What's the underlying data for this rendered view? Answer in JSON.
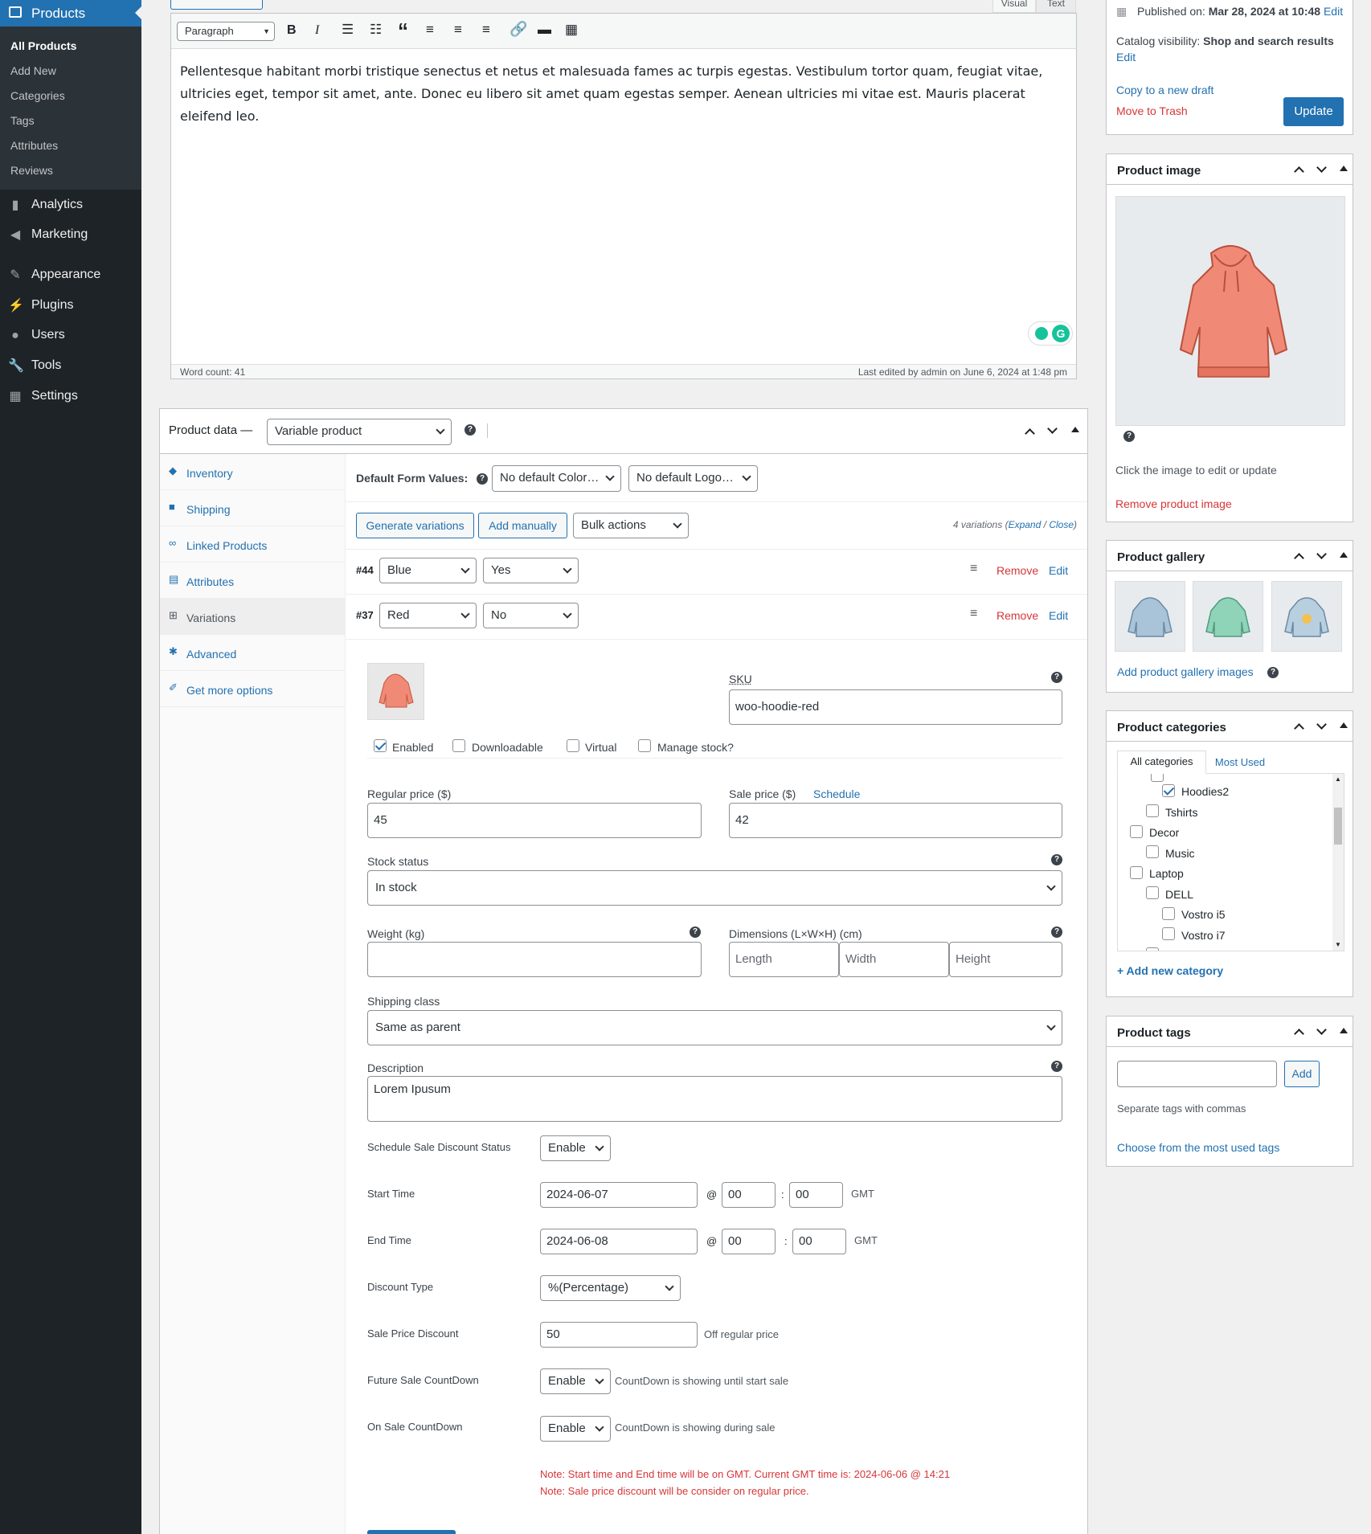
{
  "sidebar": {
    "products_label": "Products",
    "submenu": [
      "All Products",
      "Add New",
      "Categories",
      "Tags",
      "Attributes",
      "Reviews"
    ],
    "menu": [
      {
        "label": "Analytics",
        "icon": "bar-chart-icon"
      },
      {
        "label": "Marketing",
        "icon": "megaphone-icon"
      },
      {
        "label": "Appearance",
        "icon": "paintbrush-icon"
      },
      {
        "label": "Plugins",
        "icon": "plug-icon"
      },
      {
        "label": "Users",
        "icon": "user-icon"
      },
      {
        "label": "Tools",
        "icon": "wrench-icon"
      },
      {
        "label": "Settings",
        "icon": "settings-icon"
      }
    ]
  },
  "editor": {
    "tab_visual": "Visual",
    "tab_text": "Text",
    "format_select": "Paragraph",
    "content": "Pellentesque habitant morbi tristique senectus et netus et malesuada fames ac turpis egestas. Vestibulum tortor quam, feugiat vitae, ultricies eget, tempor sit amet, ante. Donec eu libero sit amet quam egestas semper. Aenean ultricies mi vitae est. Mauris placerat eleifend leo.",
    "word_count": "Word count: 41",
    "last_edited": "Last edited by admin on June 6, 2024 at 1:48 pm"
  },
  "product_data": {
    "title": "Product data —",
    "type_select": "Variable product",
    "tabs": [
      "Inventory",
      "Shipping",
      "Linked Products",
      "Attributes",
      "Variations",
      "Advanced",
      "Get more options"
    ],
    "default_form_values_label": "Default Form Values:",
    "default_color": "No default Color…",
    "default_logo": "No default Logo…",
    "generate_variations": "Generate variations",
    "add_manually": "Add manually",
    "bulk_actions": "Bulk actions",
    "variations_count": "4 variations",
    "expand": "Expand",
    "slash": "/",
    "close": "Close",
    "variations": [
      {
        "id": "#44",
        "color": "Blue",
        "logo": "Yes",
        "remove": "Remove",
        "edit": "Edit"
      },
      {
        "id": "#37",
        "color": "Red",
        "logo": "No",
        "remove": "Remove",
        "edit": "Edit"
      }
    ],
    "variation_detail": {
      "sku_label": "SKU",
      "sku_value": "woo-hoodie-red",
      "enabled": "Enabled",
      "downloadable": "Downloadable",
      "virtual": "Virtual",
      "manage_stock": "Manage stock?",
      "regular_price_label": "Regular price ($)",
      "regular_price": "45",
      "sale_price_label": "Sale price ($)",
      "schedule": "Schedule",
      "sale_price": "42",
      "stock_status_label": "Stock status",
      "stock_status": "In stock",
      "weight_label": "Weight (kg)",
      "dimensions_label": "Dimensions (L×W×H) (cm)",
      "length_ph": "Length",
      "width_ph": "Width",
      "height_ph": "Height",
      "shipping_class_label": "Shipping class",
      "shipping_class": "Same as parent",
      "description_label": "Description",
      "description": "Lorem Ipusum",
      "schedule_status_label": "Schedule Sale Discount Status",
      "schedule_status": "Enable",
      "start_time_label": "Start Time",
      "start_date": "2024-06-07",
      "start_hour": "00",
      "start_min": "00",
      "end_time_label": "End Time",
      "end_date": "2024-06-08",
      "end_hour": "00",
      "end_min": "00",
      "at": "@",
      "colon": ":",
      "gmt": "GMT",
      "discount_type_label": "Discount Type",
      "discount_type": "%(Percentage)",
      "sale_price_discount_label": "Sale Price Discount",
      "sale_price_discount": "50",
      "off_regular": "Off regular price",
      "future_countdown_label": "Future Sale CountDown",
      "future_countdown": "Enable",
      "future_countdown_note": "CountDown is showing until start sale",
      "on_sale_countdown_label": "On Sale CountDown",
      "on_sale_countdown": "Enable",
      "on_sale_countdown_note": "CountDown is showing during sale",
      "note1": "Note: Start time and End time will be on GMT. Current GMT time is: 2024-06-06 @ 14:21",
      "note2": "Note: Sale price discount will be consider on regular price."
    }
  },
  "publish": {
    "published_on_label": "Published on:",
    "published_on": "Mar 28, 2024 at 10:48",
    "edit": "Edit",
    "catalog_label": "Catalog visibility:",
    "catalog_value": "Shop and search results",
    "catalog_edit": "Edit",
    "copy_draft": "Copy to a new draft",
    "move_trash": "Move to Trash",
    "update": "Update"
  },
  "product_image": {
    "title": "Product image",
    "hint": "Click the image to edit or update",
    "remove": "Remove product image"
  },
  "product_gallery": {
    "title": "Product gallery",
    "add": "Add product gallery images"
  },
  "product_categories": {
    "title": "Product categories",
    "tab_all": "All categories",
    "tab_most": "Most Used",
    "items": [
      {
        "label": "Hoodies2",
        "checked": true
      },
      {
        "label": "Tshirts",
        "checked": false
      },
      {
        "label": "Decor",
        "checked": false
      },
      {
        "label": "Music",
        "checked": false
      },
      {
        "label": "Laptop",
        "checked": false
      },
      {
        "label": "DELL",
        "checked": false
      },
      {
        "label": "Vostro i5",
        "checked": false
      },
      {
        "label": "Vostro i7",
        "checked": false
      }
    ],
    "add_new": "+ Add new category"
  },
  "product_tags": {
    "title": "Product tags",
    "add": "Add",
    "hint": "Separate tags with commas",
    "choose": "Choose from the most used tags"
  },
  "colors": {
    "accent": "#2271b1",
    "sidebar": "#1d2327",
    "danger": "#d63638"
  }
}
